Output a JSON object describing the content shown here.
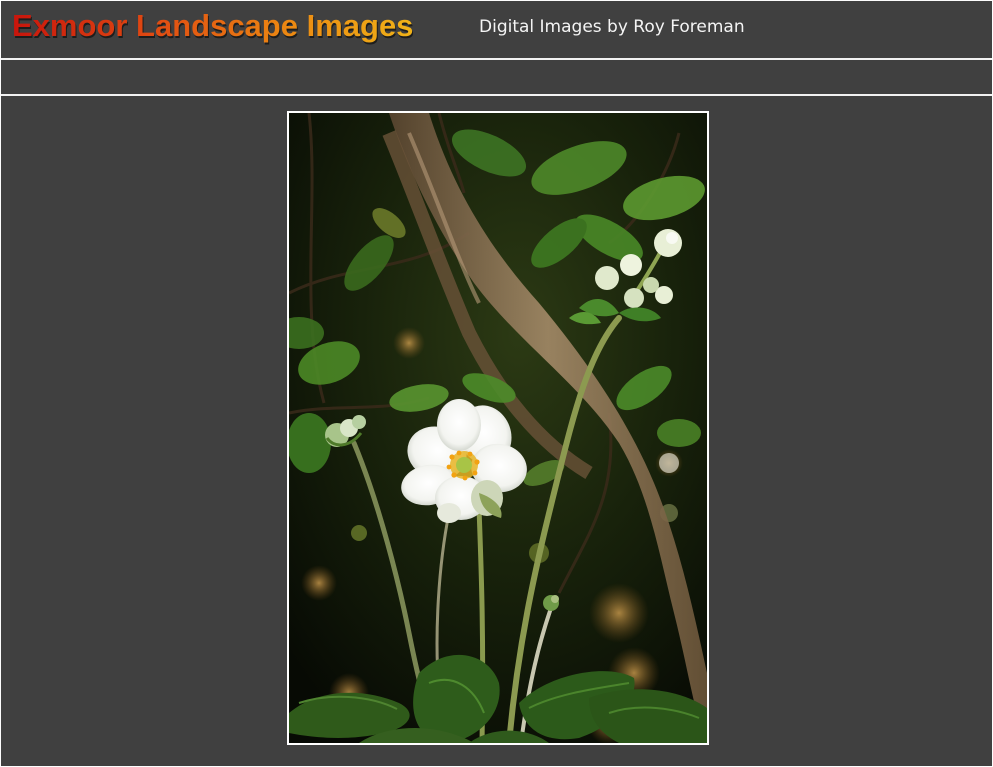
{
  "header": {
    "title": "Exmoor Landscape Images",
    "subtitle": "Digital Images by Roy Foreman"
  },
  "nav": {
    "items": []
  },
  "photo": {
    "subject": "white-anemone-flower-photo"
  },
  "colors": {
    "background": "#404040",
    "rule": "#f2f2f2",
    "title_gradient_start": "#c8150c",
    "title_gradient_end": "#f0b218",
    "subtitle": "#f4f4f4",
    "photo_border": "#ffffff"
  }
}
